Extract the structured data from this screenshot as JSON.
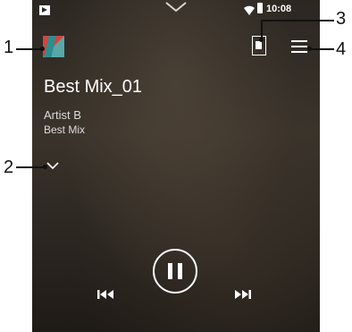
{
  "status_bar": {
    "time": "10:08"
  },
  "track": {
    "title": "Best Mix_01",
    "artist": "Artist B",
    "album": "Best Mix"
  },
  "callouts": {
    "album_art": "1",
    "expand": "2",
    "rec": "3",
    "menu": "4"
  },
  "icons": {
    "status": "play-status-icon",
    "pulldown": "chevron-down-icon",
    "album_art": "album-art-icon",
    "rec": "rec-icon",
    "menu": "menu-icon",
    "expand": "chevron-down-icon",
    "prev": "skip-previous-icon",
    "pause": "pause-icon",
    "next": "skip-next-icon"
  }
}
